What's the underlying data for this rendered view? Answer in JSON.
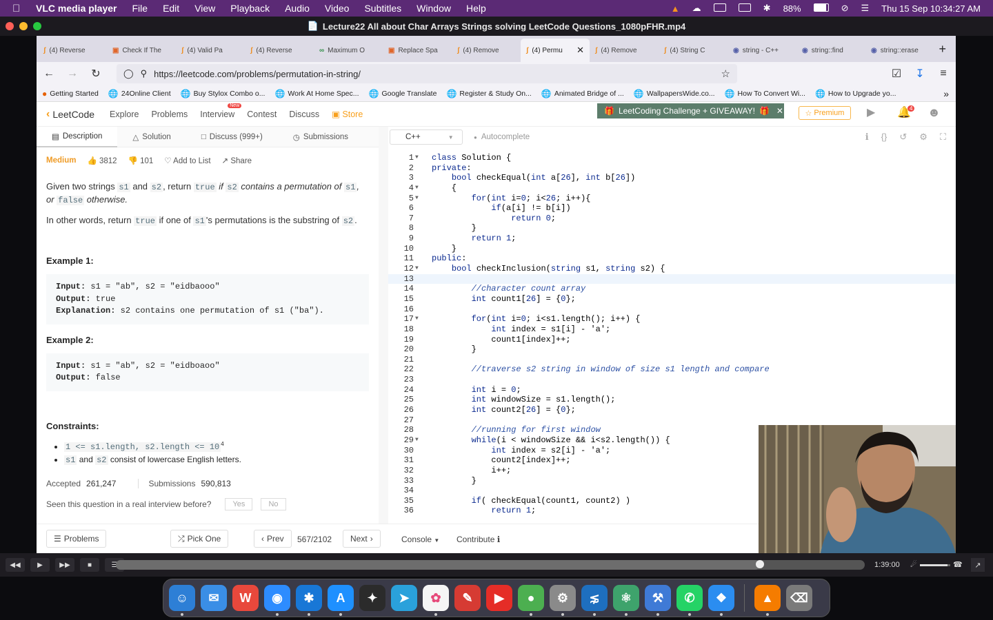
{
  "menubar": {
    "app": "VLC media player",
    "menus": [
      "File",
      "Edit",
      "View",
      "Playback",
      "Audio",
      "Video",
      "Subtitles",
      "Window",
      "Help"
    ],
    "battery": "88%",
    "datetime": "Thu 15 Sep  10:34:27 AM"
  },
  "vlc": {
    "title": "Lecture22 All about Char Arrays Strings  solving LeetCode Questions_1080pFHR.mp4",
    "elapsed_fraction": 0.86,
    "total_time": "1:39:00",
    "volume_fraction": 0.9
  },
  "browser": {
    "tabs": [
      {
        "label": "(4) Reverse",
        "favicon": "lc-icon"
      },
      {
        "label": "Check If The",
        "favicon": "gfg-icon"
      },
      {
        "label": "(4) Valid Pa",
        "favicon": "lc-icon"
      },
      {
        "label": "(4) Reverse",
        "favicon": "lc-icon"
      },
      {
        "label": "Maximum O",
        "favicon": "gfg-icon"
      },
      {
        "label": "Replace Spa",
        "favicon": "gfg-icon"
      },
      {
        "label": "(4) Remove",
        "favicon": "lc-icon"
      },
      {
        "label": "(4) Permu",
        "favicon": "lc-icon"
      },
      {
        "label": "(4) Remove",
        "favicon": "lc-icon"
      },
      {
        "label": "(4) String C",
        "favicon": "lc-icon"
      },
      {
        "label": "string - C++",
        "favicon": "cpp-icon"
      },
      {
        "label": "string::find",
        "favicon": "cpp-icon"
      },
      {
        "label": "string::erase",
        "favicon": "cpp-icon"
      }
    ],
    "url": "https://leetcode.com/problems/permutation-in-string/",
    "bookmarks": [
      "Getting Started",
      "24Online Client",
      "Buy Stylox Combo o...",
      "Work At Home Spec...",
      "Google Translate",
      "Register & Study On...",
      "Animated Bridge of ...",
      "WallpapersWide.co...",
      "How To Convert Wi...",
      "How to Upgrade yo..."
    ]
  },
  "lc": {
    "logo": "LeetCode",
    "nav": [
      "Explore",
      "Problems",
      "Interview",
      "Contest",
      "Discuss"
    ],
    "new_badge": "New",
    "store": "Store",
    "banner": "LeetCoding Challenge + GIVEAWAY!",
    "premium": "Premium",
    "notif_count": "4",
    "tabs": [
      "Description",
      "Solution",
      "Discuss (999+)",
      "Submissions"
    ],
    "difficulty": "Medium",
    "likes": "3812",
    "dislikes": "101",
    "add_list": "Add to List",
    "share": "Share",
    "desc1": [
      "Given two strings ",
      "s1",
      " and ",
      "s2",
      ", return ",
      "true",
      " if ",
      "s2",
      " contains a permutation of ",
      "s1",
      ", or ",
      "false",
      " otherwise."
    ],
    "desc2": [
      "In other words, return ",
      "true",
      " if one of ",
      "s1",
      "'s permutations is the substring of ",
      "s2",
      "."
    ],
    "ex1_title": "Example 1:",
    "ex1": {
      "input_label": "Input:",
      "input": " s1 = \"ab\", s2 = \"eidbaooo\"",
      "output_label": "Output:",
      "output": " true",
      "expl_label": "Explanation:",
      "expl": " s2 contains one permutation of s1 (\"ba\")."
    },
    "ex2_title": "Example 2:",
    "ex2": {
      "input_label": "Input:",
      "input": " s1 = \"ab\", s2 = \"eidboaoo\"",
      "output_label": "Output:",
      "output": " false"
    },
    "constraints_title": "Constraints:",
    "c1": "1 <= s1.length, s2.length <= 10",
    "c1_sup": "4",
    "c2": [
      "s1",
      " and ",
      "s2",
      " consist of lowercase English letters."
    ],
    "accepted_label": "Accepted",
    "accepted": "261,247",
    "submissions_label": "Submissions",
    "submissions": "590,813",
    "seen": "Seen this question in a real interview before?",
    "yes": "Yes",
    "no": "No",
    "language": "C++",
    "autocomplete": "Autocomplete",
    "bottom": {
      "problems": "Problems",
      "pick": "Pick One",
      "prev": "Prev",
      "page": "567/2102",
      "next": "Next",
      "console": "Console",
      "contribute": "Contribute"
    }
  },
  "code": [
    "class Solution {",
    "private:",
    "    bool checkEqual(int a[26], int b[26])",
    "    {",
    "        for(int i=0; i<26; i++){",
    "            if(a[i] != b[i])",
    "                return 0;",
    "        }",
    "        return 1;",
    "    }",
    "public:",
    "    bool checkInclusion(string s1, string s2) {",
    "",
    "        //character count array",
    "        int count1[26] = {0};",
    "",
    "        for(int i=0; i<s1.length(); i++) {",
    "            int index = s1[i] - 'a';",
    "            count1[index]++;",
    "        }",
    "",
    "        //traverse s2 string in window of size s1 length and compare",
    "",
    "        int i = 0;",
    "        int windowSize = s1.length();",
    "        int count2[26] = {0};",
    "",
    "        //running for first window",
    "        while(i < windowSize && i<s2.length()) {",
    "            int index = s2[i] - 'a';",
    "            count2[index]++;",
    "            i++;",
    "        }",
    "",
    "        if( checkEqual(count1, count2) )",
    "            return 1;"
  ],
  "fold_lines": [
    1,
    4,
    5,
    12,
    17,
    29
  ],
  "active_line": 13,
  "dock": [
    "finder",
    "mail",
    "wps",
    "zoom",
    "acrobat",
    "app-store",
    "davinci",
    "telegram",
    "photos",
    "spark",
    "youtube",
    "chrome",
    "system-prefs",
    "vscode",
    "atom",
    "xcode",
    "whatsapp",
    "safari",
    "vlc",
    "trash"
  ]
}
